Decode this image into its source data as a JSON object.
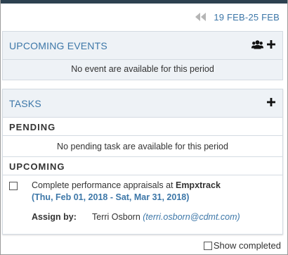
{
  "date_nav": {
    "range": "19 FEB-25 FEB",
    "prev_icon": "double-chevron-left-icon",
    "color": "#3d77a8"
  },
  "upcoming_events": {
    "title": "UPCOMING EVENTS",
    "group_icon": "users-group-icon",
    "add_icon": "plus-icon",
    "empty_message": "No event are available for this period"
  },
  "tasks": {
    "title": "TASKS",
    "add_icon": "plus-icon",
    "pending": {
      "label": "PENDING",
      "empty_message": "No pending task are available for this period"
    },
    "upcoming": {
      "label": "UPCOMING",
      "items": [
        {
          "text": "Complete performance appraisals at",
          "org": "Empxtrack",
          "dates": "(Thu, Feb 01, 2018 - Sat, Mar 31, 2018)",
          "assign_label": "Assign by:",
          "assignee": "Terri Osborn",
          "email": "(terri.osborn@cdmt.com)",
          "checked": false
        }
      ]
    }
  },
  "show_completed": {
    "label": "Show completed",
    "checked": false
  }
}
